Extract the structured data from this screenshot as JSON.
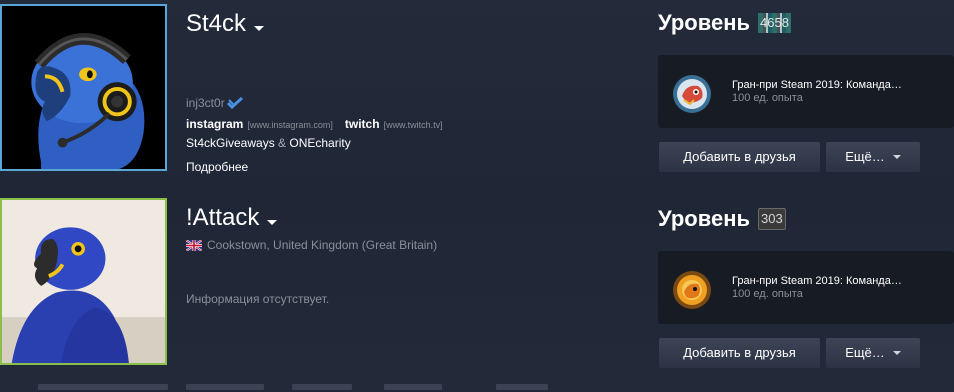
{
  "profiles": [
    {
      "name": "St4ck",
      "real_name": "inj3ct0r",
      "links": [
        {
          "label": "instagram",
          "url": "[www.instagram.com]"
        },
        {
          "label": "twitch",
          "url": "[www.twitch.tv]"
        }
      ],
      "groups": {
        "first": "St4ckGiveaways",
        "amp": " & ",
        "second": "ONEcharity"
      },
      "more_link": "Подробнее",
      "level_label": "Уровень",
      "level_value": "4658",
      "badge": {
        "name": "Гран-при Steam 2019: Команда…",
        "xp": "100 ед. опыта",
        "icon": "grand-prix-red-badge-icon"
      },
      "add_friend_label": "Добавить в друзья",
      "more_menu_label": "Ещё…"
    },
    {
      "name": "!Attack",
      "location": "Cookstown, United Kingdom (Great Britain)",
      "no_info": "Информация отсутствует.",
      "level_label": "Уровень",
      "level_value": "303",
      "badge": {
        "name": "Гран-при Steam 2019: Команда…",
        "xp": "100 ед. опыта",
        "icon": "grand-prix-orange-badge-icon"
      },
      "add_friend_label": "Добавить в друзья",
      "more_menu_label": "Ещё…"
    }
  ],
  "colors": {
    "accent_online": "#5aa6d6",
    "accent_ingame": "#8cbf4a",
    "panel_bg": "#171b24",
    "page_bg": "#1f2636"
  }
}
